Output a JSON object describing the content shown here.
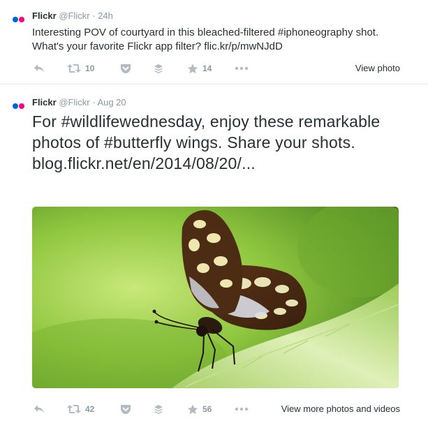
{
  "colors": {
    "flickr_blue": "#0063dc",
    "flickr_pink": "#ff0084",
    "text": "#292f33",
    "muted": "#8899a6",
    "icon": "#b1bbc3"
  },
  "tweets": [
    {
      "name": "Flickr",
      "handle": "@Flickr",
      "separator": "·",
      "time": "24h",
      "text": "Interesting POV of courtyard in this bleached-filtered #iphoneography shot. What's your favorite Flickr app filter? flic.kr/p/mwNJdD",
      "retweets": "10",
      "favorites": "14",
      "link_label": "View photo",
      "icons": [
        "reply-icon",
        "retweet-icon",
        "pocket-icon",
        "buffer-icon",
        "favorite-icon",
        "more-icon"
      ]
    },
    {
      "name": "Flickr",
      "handle": "@Flickr",
      "separator": "·",
      "time": "Aug 20",
      "text": "For #wildlifewednesday, enjoy these remarkable photos of #butterfly wings. Share your shots. blog.flickr.net/en/2014/08/20/...",
      "image": "butterfly-photo",
      "retweets": "42",
      "favorites": "56",
      "link_label": "View more photos and videos",
      "icons": [
        "reply-icon",
        "retweet-icon",
        "pocket-icon",
        "buffer-icon",
        "favorite-icon",
        "more-icon"
      ]
    }
  ]
}
